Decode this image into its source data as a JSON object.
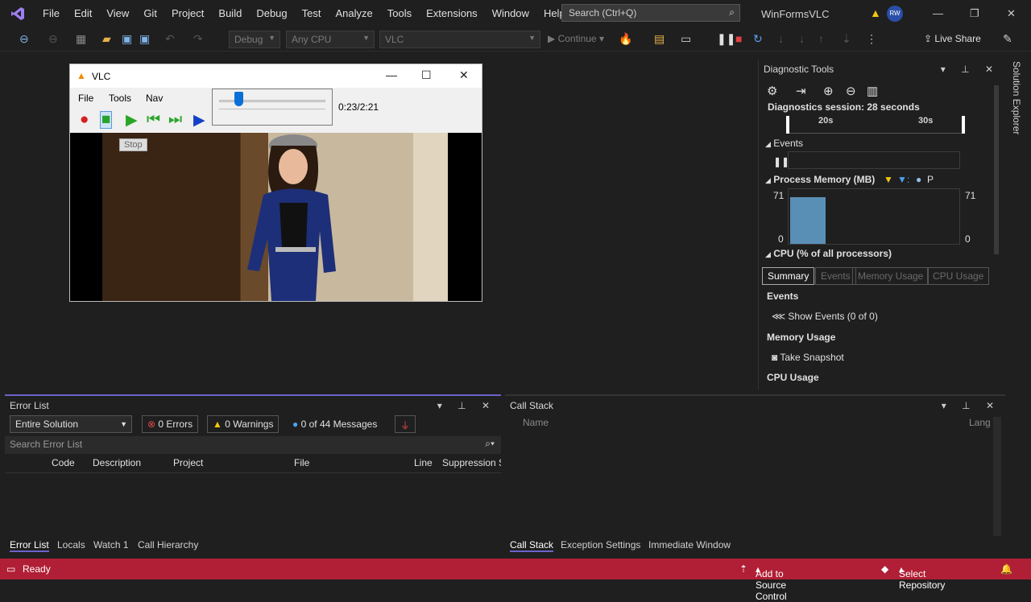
{
  "titlebar": {
    "menu": [
      "File",
      "Edit",
      "View",
      "Git",
      "Project",
      "Build",
      "Debug",
      "Test",
      "Analyze",
      "Tools",
      "Extensions",
      "Window",
      "Help"
    ],
    "search_placeholder": "Search (Ctrl+Q)",
    "solution_name": "WinFormsVLC",
    "avatar_initials": "RW"
  },
  "toolbar": {
    "config": "Debug",
    "platform": "Any CPU",
    "startup_project": "VLC",
    "continue_label": "Continue",
    "live_share": "Live Share"
  },
  "vlc": {
    "title": "VLC",
    "menu": [
      "File",
      "Tools",
      "Nav"
    ],
    "time": "0:23/2:21",
    "tooltip": "Stop",
    "seek_fraction": 0.16
  },
  "diagnostics": {
    "title": "Diagnostic Tools",
    "session": "Diagnostics session: 28 seconds",
    "ruler_ticks": [
      "20s",
      "30s"
    ],
    "events_label": "Events",
    "memory_label": "Process Memory (MB)",
    "memory_legend_p": "P",
    "mem_max_left": "71",
    "mem_max_right": "71",
    "mem_min_left": "0",
    "mem_min_right": "0",
    "cpu_label": "CPU (% of all processors)",
    "tabs": [
      "Summary",
      "Events",
      "Memory Usage",
      "CPU Usage"
    ],
    "summary_events_heading": "Events",
    "show_events": "Show Events (0 of 0)",
    "memory_usage_heading": "Memory Usage",
    "take_snapshot": "Take Snapshot",
    "cpu_usage_heading": "CPU Usage"
  },
  "sidebar": {
    "solution_explorer": "Solution Explorer"
  },
  "error_list": {
    "title": "Error List",
    "scope": "Entire Solution",
    "errors": "0 Errors",
    "warnings": "0 Warnings",
    "messages": "0 of 44 Messages",
    "search_placeholder": "Search Error List",
    "columns": [
      "Code",
      "Description",
      "Project",
      "File",
      "Line",
      "Suppression S"
    ],
    "bottom_tabs": [
      "Error List",
      "Locals",
      "Watch 1",
      "Call Hierarchy"
    ]
  },
  "call_stack": {
    "title": "Call Stack",
    "columns": [
      "Name",
      "Lang"
    ],
    "bottom_tabs": [
      "Call Stack",
      "Exception Settings",
      "Immediate Window"
    ]
  },
  "status": {
    "ready": "Ready",
    "source_control": "Add to Source Control",
    "repository": "Select Repository",
    "colors": {
      "bar": "#b01f35"
    }
  }
}
